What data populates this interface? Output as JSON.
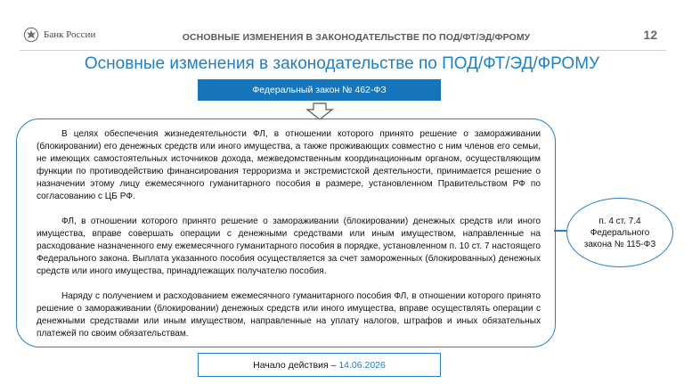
{
  "header": {
    "logo_text": "Банк России",
    "title": "ОСНОВНЫЕ ИЗМЕНЕНИЯ В ЗАКОНОДАТЕЛЬСТВЕ ПО ПОД/ФТ/ЭД/ФРОМУ",
    "page_number": "12"
  },
  "main": {
    "title": "Основные изменения в законодательстве по ПОД/ФТ/ЭД/ФРОМУ",
    "law_label": "Федеральный закон № 462-ФЗ",
    "paragraphs": [
      "В целях обеспечения жизнедеятельности ФЛ, в отношении которого принято решение о замораживании (блокировании) его денежных средств или иного имущества, а также проживающих совместно с ним членов его семьи, не имеющих самостоятельных источников дохода, межведомственным координационным органом, осуществляющим функции по противодействию финансирования терроризма и экстремистской деятельности, принимается решение о назначении этому лицу ежемесячного гуманитарного пособия в размере, установленном Правительством РФ по согласованию с ЦБ РФ.",
      "ФЛ, в отношении которого принято решение о замораживании (блокировании) денежных средств или иного имущества, вправе совершать операции с денежными средствами или иным имуществом, направленные на расходование назначенного ему ежемесячного гуманитарного пособия в порядке, установленном п. 10 ст. 7 настоящего Федерального закона. Выплата указанного пособия осуществляется за счет замороженных (блокированных) денежных средств или иного имущества, принадлежащих получателю пособия.",
      "Наряду с получением и расходованием ежемесячного гуманитарного пособия ФЛ, в отношении которого принято решение о замораживании (блокировании) денежных средств или иного имущества, вправе осуществлять операции с денежными средствами или иным имуществом, направленные на уплату налогов, штрафов и иных обязательных платежей по своим обязательствам."
    ],
    "reference": "п. 4 ст. 7.4 Федерального закона № 115-ФЗ",
    "effective_label": "Начало действия – ",
    "effective_date": "14.06.2026"
  },
  "colors": {
    "accent": "#1f7fc9",
    "badge_bg": "#1576bd",
    "border": "#2a7fc7"
  },
  "icons": {
    "logo": "eagle-emblem-icon",
    "arrow": "down-arrow-icon"
  }
}
